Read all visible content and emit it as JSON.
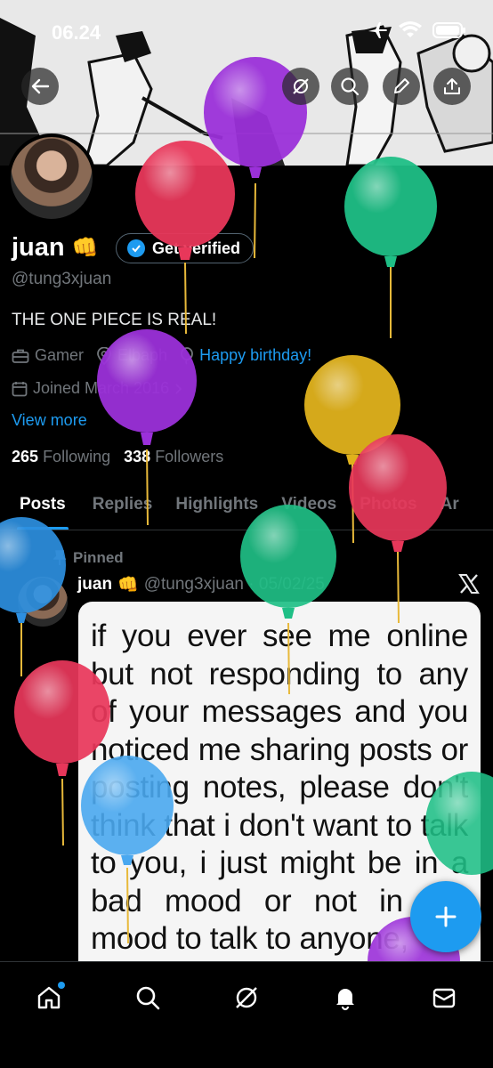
{
  "status_bar": {
    "time": "06.24"
  },
  "profile": {
    "display_name": "juan",
    "name_emoji": "👊",
    "verify_label": "Get verified",
    "handle": "@tung3xjuan",
    "bio": "THE ONE PIECE IS REAL!",
    "category": "Gamer",
    "location": "Elbaph",
    "birthday_link": "Happy birthday!",
    "joined": "Joined March 2016",
    "view_more": "View more",
    "following_count": "265",
    "following_label": "Following",
    "followers_count": "338",
    "followers_label": "Followers"
  },
  "tabs": [
    {
      "label": "Posts"
    },
    {
      "label": "Replies"
    },
    {
      "label": "Highlights"
    },
    {
      "label": "Videos"
    },
    {
      "label": "Photos"
    },
    {
      "label": "Ar"
    }
  ],
  "pinned_post": {
    "pinned_label": "Pinned",
    "name": "juan",
    "emoji": "👊",
    "handle_date": "@tung3xjuan · 05/02/25",
    "image_text": "if you ever see me online but not responding to any of your messages and you noticed me sharing posts or posting notes, please don't think that i don't want to talk to you, i just might be in a bad mood or not in the mood to talk to anyone,"
  },
  "icons": {
    "back": "back-arrow-icon",
    "grok": "grok-icon",
    "search": "search-icon",
    "edit": "pencil-icon",
    "share": "share-icon",
    "compose": "plus-icon",
    "home": "home-icon",
    "explore": "search-icon",
    "grok_nav": "grok-icon",
    "notifications": "bell-icon",
    "messages": "mail-icon"
  },
  "colors": {
    "accent": "#1d9bf0",
    "background": "#000000",
    "secondary_text": "#71767b",
    "balloon_purple": "#9b30d9",
    "balloon_red": "#e8375a",
    "balloon_green": "#1fbf86",
    "balloon_yellow": "#e0b21c",
    "balloon_blue": "#2d8fe0"
  }
}
